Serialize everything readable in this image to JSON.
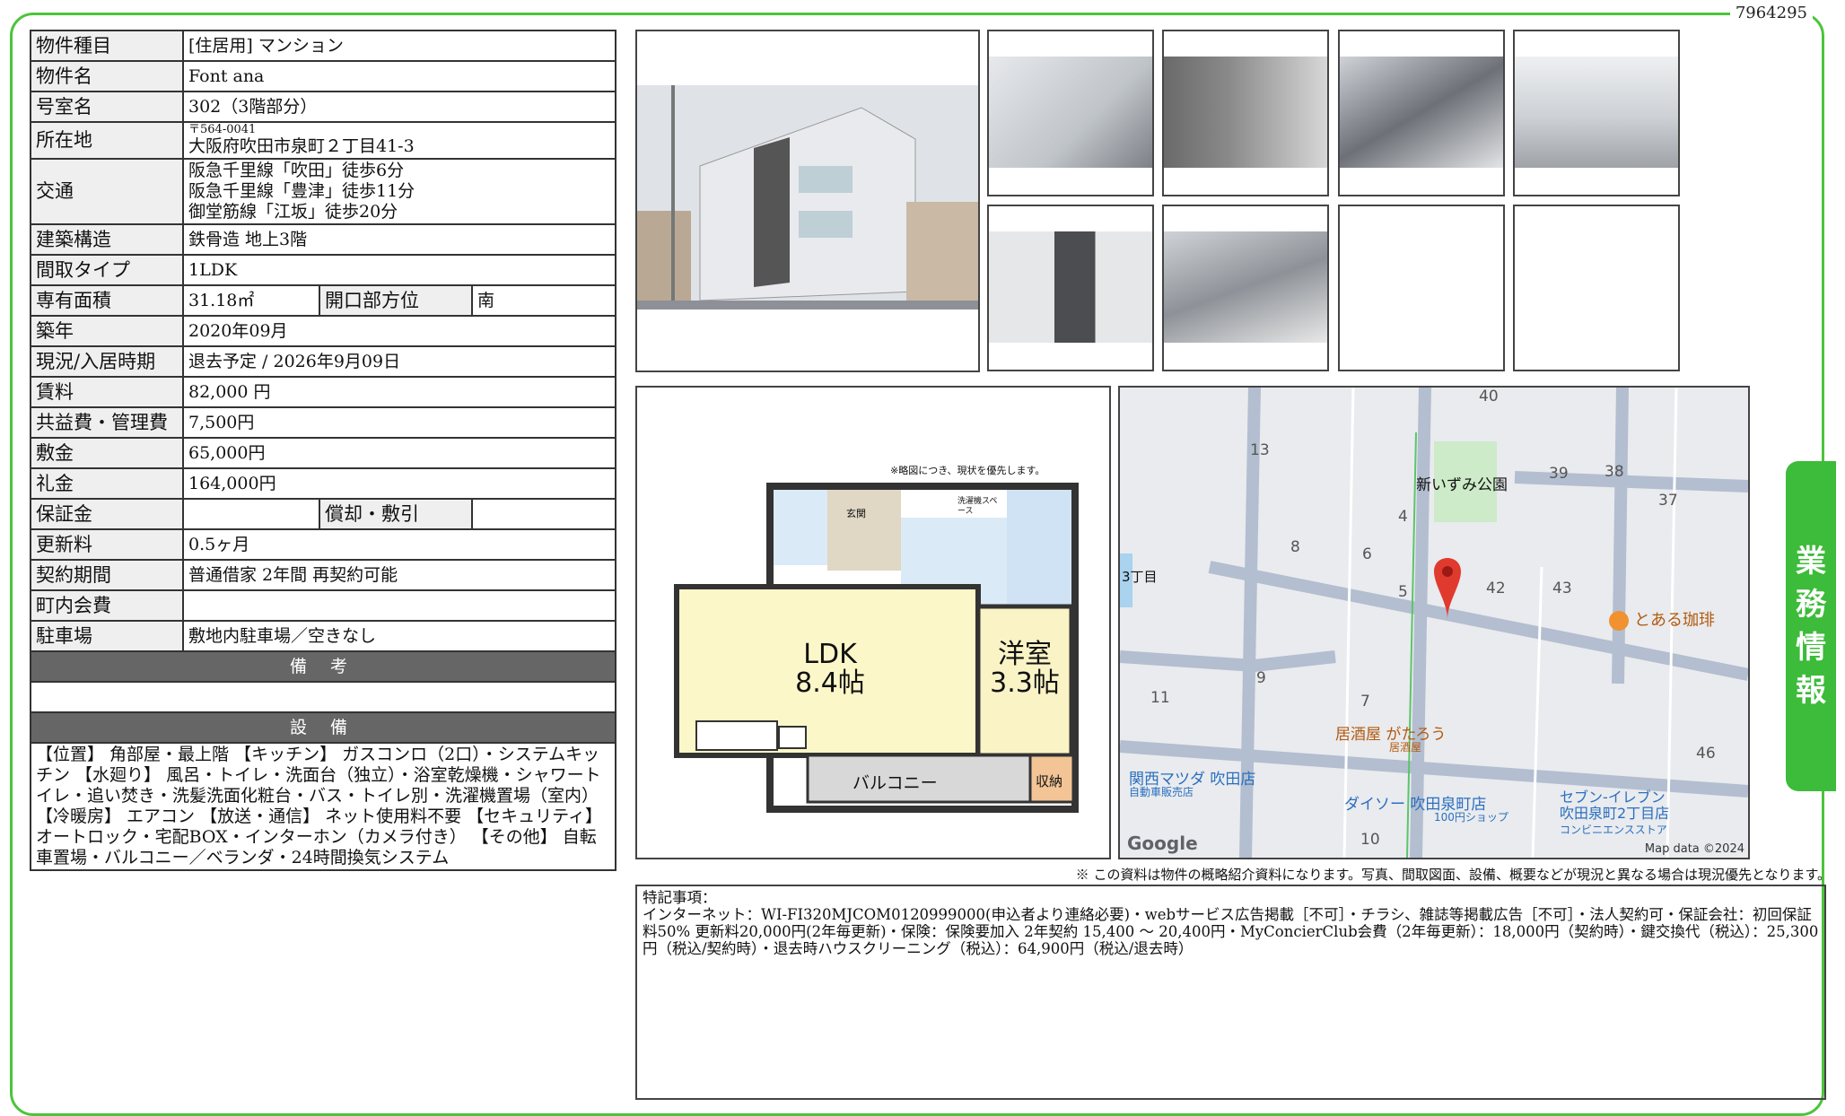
{
  "document_id": "7964295",
  "side_tab": [
    "業",
    "務",
    "情",
    "報"
  ],
  "property": {
    "type_label": "物件種目",
    "type_value": "[住居用] マンション",
    "name_label": "物件名",
    "name_value": "Font ana",
    "room_label": "号室名",
    "room_value": "302（3階部分）",
    "address_label": "所在地",
    "postal": "〒564-0041",
    "address": "大阪府吹田市泉町２丁目41-3",
    "transport_label": "交通",
    "transport": [
      "阪急千里線「吹田」徒歩6分",
      "阪急千里線「豊津」徒歩11分",
      "御堂筋線「江坂」徒歩20分"
    ],
    "structure_label": "建築構造",
    "structure_value": "鉄骨造 地上3階",
    "layout_label": "間取タイプ",
    "layout_value": "1LDK",
    "area_label": "専有面積",
    "area_value": "31.18㎡",
    "orientation_label": "開口部方位",
    "orientation_value": "南",
    "built_label": "築年",
    "built_value": "2020年09月",
    "status_label": "現況/入居時期",
    "status_value": "退去予定 / 2026年9月09日",
    "rent_label": "賃料",
    "rent_value": "82,000 円",
    "fee_label": "共益費・管理費",
    "fee_value": "7,500円",
    "deposit_label": "敷金",
    "deposit_value": "65,000円",
    "key_money_label": "礼金",
    "key_money_value": "164,000円",
    "guarantee_label": "保証金",
    "guarantee_value": "",
    "amortization_label": "償却・敷引",
    "amortization_value": "",
    "renewal_label": "更新料",
    "renewal_value": "0.5ヶ月",
    "contract_label": "契約期間",
    "contract_value": "普通借家 2年間 再契約可能",
    "community_label": "町内会費",
    "community_value": "",
    "parking_label": "駐車場",
    "parking_value": "敷地内駐車場／空きなし",
    "remarks_header": "備 考",
    "remarks_value": "",
    "equipment_header": "設 備",
    "equipment_value": "【位置】 角部屋・最上階 【キッチン】 ガスコンロ（2口）・システムキッチン 【水廻り】 風呂・トイレ・洗面台（独立）・浴室乾燥機・シャワートイレ・追い焚き・洗髪洗面化粧台・バス・トイレ別・洗濯機置場（室内） 【冷暖房】 エアコン 【放送・通信】 ネット使用料不要 【セキュリティ】 オートロック・宅配BOX・インターホン（カメラ付き） 【その他】 自転車置場・バルコニー／ベランダ・24時間換気システム"
  },
  "floorplan": {
    "note": "※略図につき、現状を優先します。",
    "ldk": "LDK",
    "ldk_size": "8.4帖",
    "western": "洋室",
    "western_size": "3.3帖",
    "balcony": "バルコニー",
    "storage": "収納",
    "entrance": "玄関",
    "washer": "洗濯機スペース"
  },
  "map": {
    "park": "新いずみ公園",
    "cafe": "とある珈琲",
    "izakaya": "居酒屋 がたろう",
    "izakaya_sub": "居酒屋",
    "mazda": "関西マツダ 吹田店",
    "mazda_sub": "自動車販売店",
    "daiso": "ダイソー 吹田泉町店",
    "daiso_sub": "100円ショップ",
    "seven": "セブン-イレブン",
    "seven2": "吹田泉町2丁目店",
    "seven_sub": "コンビニエンスストア",
    "area": "3丁目",
    "blocks": [
      "40",
      "13",
      "39",
      "38",
      "37",
      "4",
      "8",
      "6",
      "5",
      "42",
      "43",
      "9",
      "11",
      "7",
      "10",
      "46"
    ],
    "google": "Google",
    "copyright": "Map data ©2024"
  },
  "disclaimer": "※ この資料は物件の概略紹介資料になります。写真、間取図面、設備、概要などが現況と異なる場合は現況優先となります。",
  "special": {
    "title": "特記事項：",
    "body": "インターネット：WI-FI320MJCOM0120999000(申込者より連絡必要)・webサービス広告掲載［不可］・チラシ、雑誌等掲載広告［不可］・法人契約可・保証会社：初回保証料50% 更新料20,000円(2年毎更新)・保険：保険要加入 2年契約 15,400 〜 20,400円・MyConcierClub会費（2年毎更新）：18,000円（契約時）・鍵交換代（税込）：25,300円（税込/契約時）・退去時ハウスクリーニング（税込）：64,900円（税込/退去時）"
  },
  "colors": {
    "frame": "#4cc43c",
    "tab": "#3dbb3a",
    "label_bg": "#efefef",
    "section_bg": "#666666",
    "pin": "#e03a2f",
    "park": "#cdeac9"
  }
}
